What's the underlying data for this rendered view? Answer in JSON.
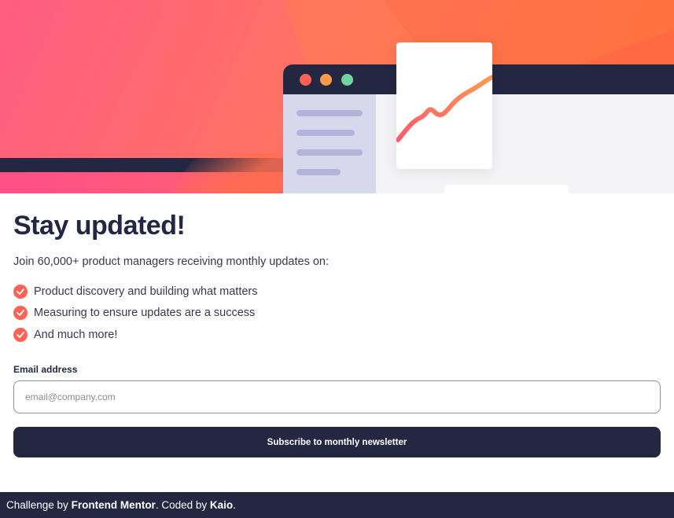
{
  "hero": {
    "illustration_icon": "analytics-dashboard-illustration",
    "colors": {
      "gradient_start": "#ff527b",
      "gradient_end": "#ff6a3d",
      "navy": "#242742",
      "dot_red": "#ff6155",
      "dot_orange": "#ff9a4d",
      "dot_green": "#6fd5a3",
      "sidebar": "#d8d8ec",
      "sidebar_lines": "#b3b3db"
    }
  },
  "main": {
    "title": "Stay updated!",
    "intro": "Join 60,000+ product managers receiving monthly updates on:",
    "features": [
      {
        "icon": "check-icon",
        "text": "Product discovery and building what matters"
      },
      {
        "icon": "check-icon",
        "text": "Measuring to ensure updates are a success"
      },
      {
        "icon": "check-icon",
        "text": "And much more!"
      }
    ]
  },
  "form": {
    "email_label": "Email address",
    "email_placeholder": "email@company.com",
    "email_value": "",
    "submit_label": "Subscribe to monthly newsletter"
  },
  "attribution": {
    "prefix": "Challenge by",
    "challenge_link": "Frontend Mentor",
    "middle": ". Coded by",
    "author_link": "Kaio",
    "suffix": "."
  },
  "theme": {
    "accent": "#ff6155",
    "dark": "#242742",
    "text": "#36384e"
  }
}
